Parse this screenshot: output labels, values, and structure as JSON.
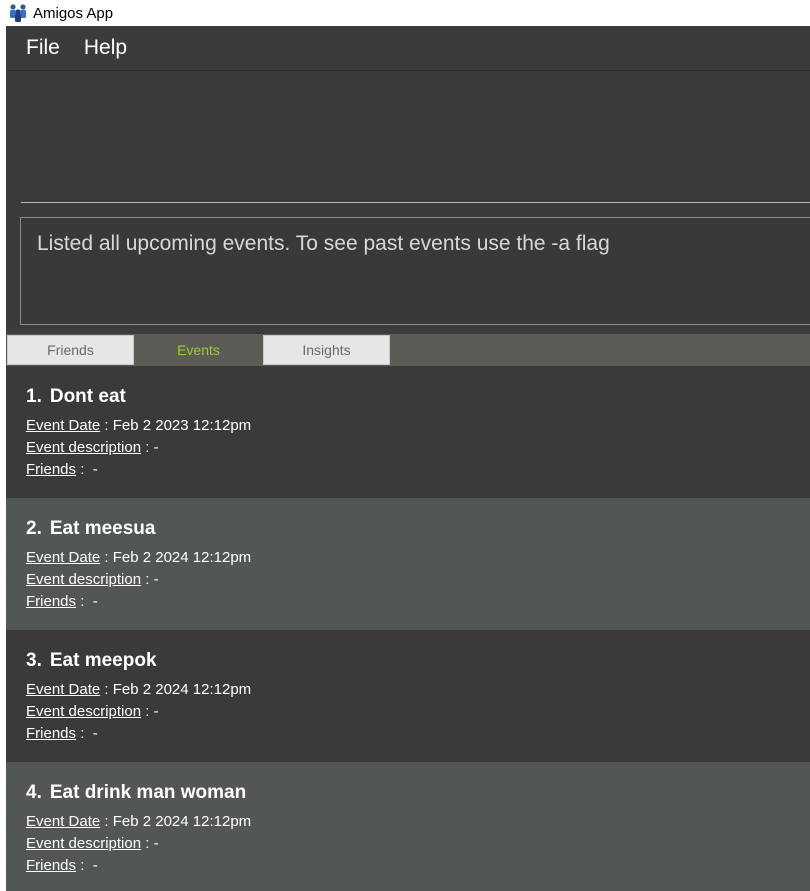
{
  "window": {
    "title": "Amigos App"
  },
  "menu": {
    "file": "File",
    "help": "Help"
  },
  "command_box": {
    "value": ""
  },
  "result": {
    "message": "Listed all upcoming events. To see past events use the -a flag"
  },
  "tabs": [
    {
      "label": "Friends",
      "active": false
    },
    {
      "label": "Events",
      "active": true
    },
    {
      "label": "Insights",
      "active": false
    }
  ],
  "field_labels": {
    "date": "Event Date",
    "description": "Event description",
    "friends": "Friends"
  },
  "events": [
    {
      "index": "1.",
      "name": "Dont eat",
      "date": ": Feb 2 2023 12:12pm",
      "description": ": -",
      "friends": " :  -"
    },
    {
      "index": "2.",
      "name": "Eat meesua",
      "date": ": Feb 2 2024 12:12pm",
      "description": ": -",
      "friends": " :  -"
    },
    {
      "index": "3.",
      "name": "Eat meepok",
      "date": ": Feb 2 2024 12:12pm",
      "description": ": -",
      "friends": " :  -"
    },
    {
      "index": "4.",
      "name": "Eat drink man woman",
      "date": ": Feb 2 2024 12:12pm",
      "description": ": -",
      "friends": " :  -"
    }
  ],
  "colors": {
    "active_tab_text": "#9acd32",
    "card_dark": "#3a3a3c",
    "card_light": "#525656",
    "background": "#3b3b3b"
  }
}
